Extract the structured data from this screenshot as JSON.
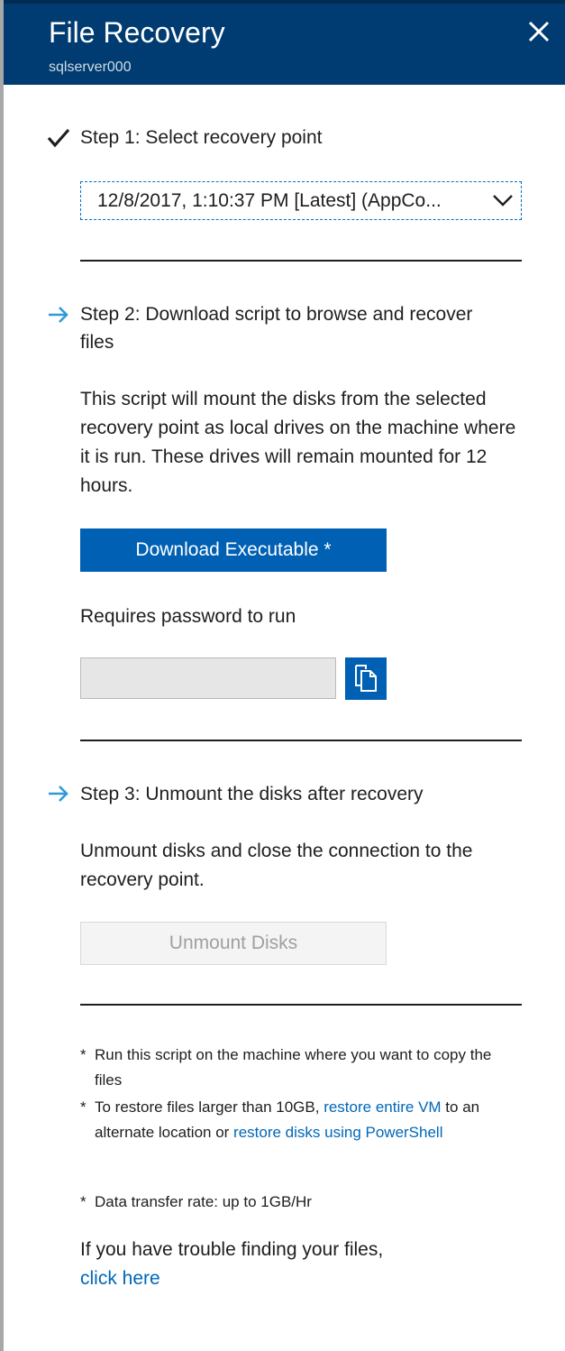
{
  "header": {
    "title": "File Recovery",
    "subtitle": "sqlserver000"
  },
  "step1": {
    "label": "Step 1: Select recovery point",
    "dropdown_value": "12/8/2017, 1:10:37 PM [Latest] (AppCo..."
  },
  "step2": {
    "label": "Step 2: Download script to browse and recover files",
    "description": "This script will mount the disks from the selected recovery point as local drives on the machine where it is run. These drives will remain mounted for 12 hours.",
    "download_button": "Download Executable *",
    "password_label": "Requires password to run",
    "password_value": ""
  },
  "step3": {
    "label": "Step 3: Unmount the disks after recovery",
    "description": "Unmount disks and close the connection to the recovery point.",
    "unmount_button": "Unmount Disks"
  },
  "notes": {
    "star": "*",
    "note1": "Run this script on the machine where you want to copy the files",
    "note2_pre": "To restore files larger than 10GB, ",
    "note2_link1": "restore entire VM",
    "note2_mid": " to an alternate location or ",
    "note2_link2": "restore disks using PowerShell",
    "note3": "Data transfer rate: up to 1GB/Hr"
  },
  "trouble": {
    "text": "If you have trouble finding your files,",
    "link": "click here"
  },
  "colors": {
    "header_bg": "#003c71",
    "primary_button": "#0060b3",
    "link": "#0067b8",
    "arrow": "#2e9bd6"
  },
  "icons": {
    "step1": "checkmark-icon",
    "step2": "arrow-right-icon",
    "step3": "arrow-right-icon",
    "close": "close-icon",
    "copy": "copy-icon",
    "dropdown": "chevron-down-icon"
  }
}
